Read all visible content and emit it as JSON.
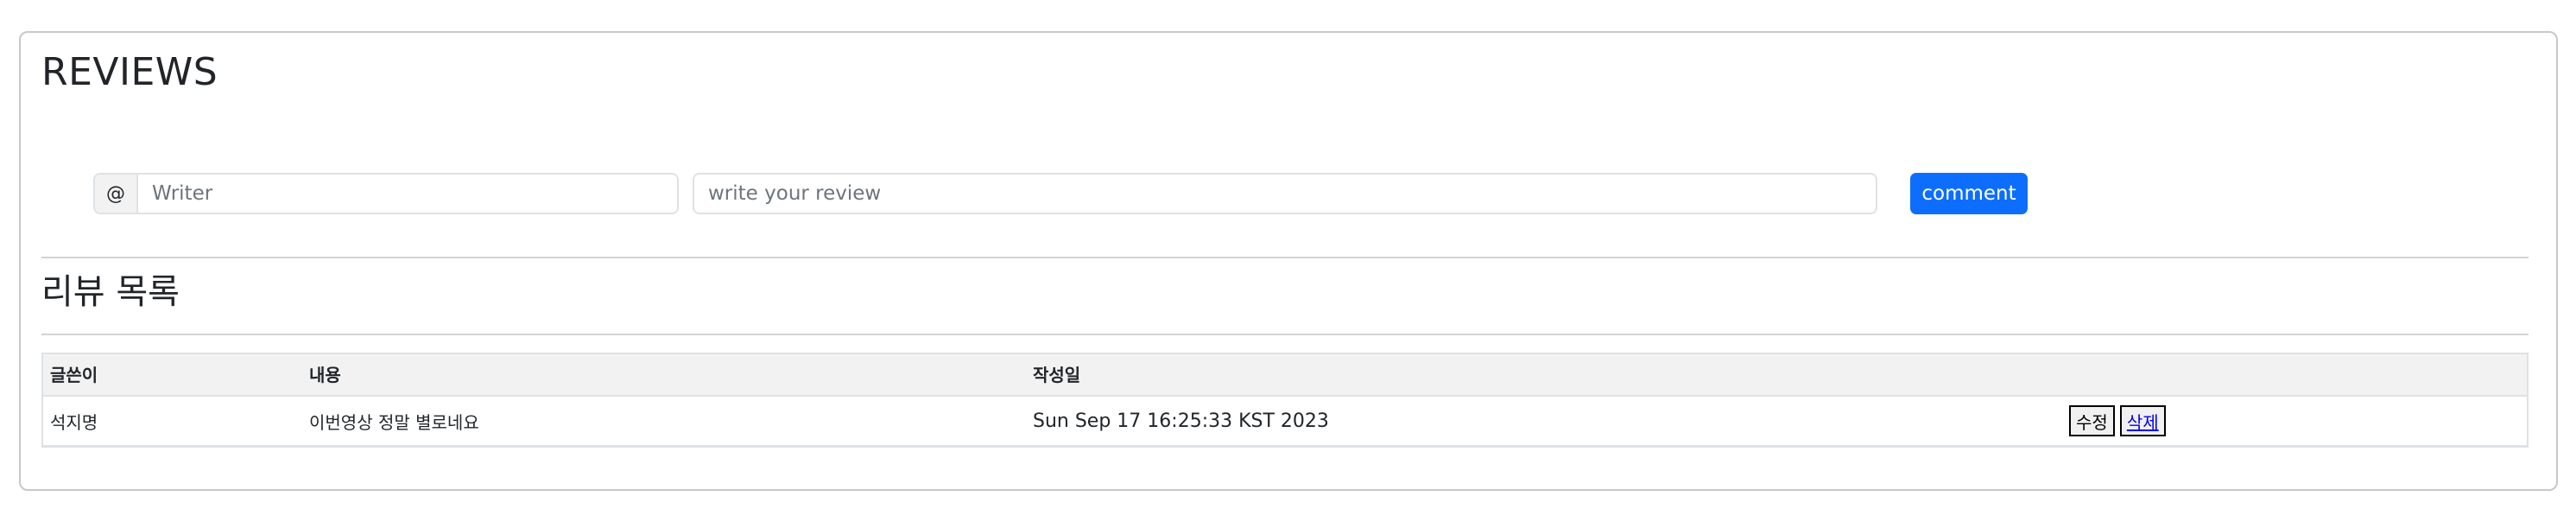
{
  "header": {
    "title": "REVIEWS"
  },
  "form": {
    "addon_symbol": "@",
    "writer_placeholder": "Writer",
    "review_placeholder": "write your review",
    "submit_label": "comment"
  },
  "list": {
    "title": "리뷰 목록",
    "columns": [
      "글쓴이",
      "내용",
      "작성일"
    ],
    "rows": [
      {
        "writer": "석지명",
        "content": "이번영상 정말 별로네요",
        "date": "Sun Sep 17 16:25:33 KST 2023",
        "edit_label": "수정",
        "delete_label": "삭제"
      }
    ]
  },
  "colors": {
    "accent": "#0d6efd",
    "header_bg": "#f2f2f2",
    "border": "#dee2e6"
  }
}
